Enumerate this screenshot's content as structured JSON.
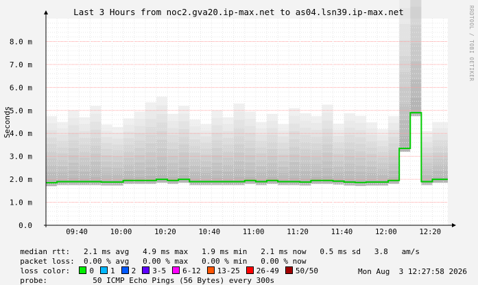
{
  "chart_data": {
    "type": "area",
    "title": "Last 3 Hours from noc2.gva20.ip-max.net to as04.lsn39.ip-max.net",
    "ylabel": "Seconds",
    "watermark": "RRDTOOL / TOBI OETIKER",
    "ylim": [
      0,
      9.0
    ],
    "y_ticks": [
      {
        "v": 0,
        "label": "0.0"
      },
      {
        "v": 1,
        "label": "1.0 m"
      },
      {
        "v": 2,
        "label": "2.0 m"
      },
      {
        "v": 3,
        "label": "3.0 m"
      },
      {
        "v": 4,
        "label": "4.0 m"
      },
      {
        "v": 5,
        "label": "5.0 m"
      },
      {
        "v": 6,
        "label": "6.0 m"
      },
      {
        "v": 7,
        "label": "7.0 m"
      },
      {
        "v": 8,
        "label": "8.0 m"
      }
    ],
    "x_range_minutes": [
      -217,
      -205.5
    ],
    "xlim": [
      "09:26",
      "12:28"
    ],
    "x_ticks": [
      "09:40",
      "10:00",
      "10:20",
      "10:40",
      "11:00",
      "11:20",
      "11:40",
      "12:00",
      "12:20"
    ],
    "median_series": {
      "name": "median rtt",
      "color": "#00cc00",
      "time": [
        "09:26",
        "09:31",
        "09:36",
        "09:41",
        "09:46",
        "09:51",
        "09:56",
        "10:01",
        "10:06",
        "10:11",
        "10:16",
        "10:21",
        "10:26",
        "10:31",
        "10:36",
        "10:41",
        "10:46",
        "10:51",
        "10:56",
        "11:01",
        "11:06",
        "11:11",
        "11:16",
        "11:21",
        "11:26",
        "11:31",
        "11:36",
        "11:41",
        "11:46",
        "11:51",
        "11:56",
        "12:01",
        "12:06",
        "12:11",
        "12:16",
        "12:21"
      ],
      "values_ms": [
        1.85,
        1.9,
        1.9,
        1.9,
        1.9,
        1.88,
        1.88,
        1.95,
        1.95,
        1.95,
        2.0,
        1.95,
        2.0,
        1.9,
        1.9,
        1.9,
        1.9,
        1.9,
        1.95,
        1.9,
        1.95,
        1.9,
        1.9,
        1.88,
        1.95,
        1.95,
        1.92,
        1.88,
        1.86,
        1.88,
        1.88,
        1.95,
        3.35,
        4.9,
        1.9,
        2.0
      ]
    },
    "smoke_spread_ms": [
      2.9,
      2.6,
      3.1,
      2.8,
      3.3,
      2.5,
      2.4,
      2.7,
      3.0,
      3.4,
      3.6,
      2.9,
      3.2,
      2.7,
      2.5,
      3.1,
      2.8,
      3.4,
      3.0,
      2.6,
      2.9,
      2.5,
      3.2,
      3.0,
      2.8,
      3.3,
      2.5,
      3.0,
      2.9,
      2.6,
      2.3,
      2.8,
      6.8,
      7.8,
      2.2,
      2.5
    ],
    "legend_colors": [
      "#00ee00",
      "#00b8ff",
      "#0059ff",
      "#5e00ff",
      "#ff00fd",
      "#ff5500",
      "#ff0000",
      "#a10000"
    ]
  },
  "stats": {
    "median_label": "median rtt:",
    "median_values": "2.1 ms avg   4.9 ms max   1.9 ms min   2.1 ms now   0.5 ms sd   3.8   am/s",
    "loss_label": "packet loss:",
    "loss_values": "0.00 % avg   0.00 % max   0.00 % min   0.00 % now"
  },
  "loss_color": {
    "label": "loss color:",
    "items": [
      {
        "label": "0",
        "color": "#00ee00"
      },
      {
        "label": "1",
        "color": "#00b8ff"
      },
      {
        "label": "2",
        "color": "#0059ff"
      },
      {
        "label": "3-5",
        "color": "#5e00ff"
      },
      {
        "label": "6-12",
        "color": "#ff00fd"
      },
      {
        "label": "13-25",
        "color": "#ff5500"
      },
      {
        "label": "26-49",
        "color": "#ff0000"
      },
      {
        "label": "50/50",
        "color": "#a10000"
      }
    ]
  },
  "probe": {
    "label": "probe:",
    "text": "50 ICMP Echo Pings (56 Bytes) every 300s",
    "timestamp": "Mon Aug  3 12:27:58 2026"
  }
}
